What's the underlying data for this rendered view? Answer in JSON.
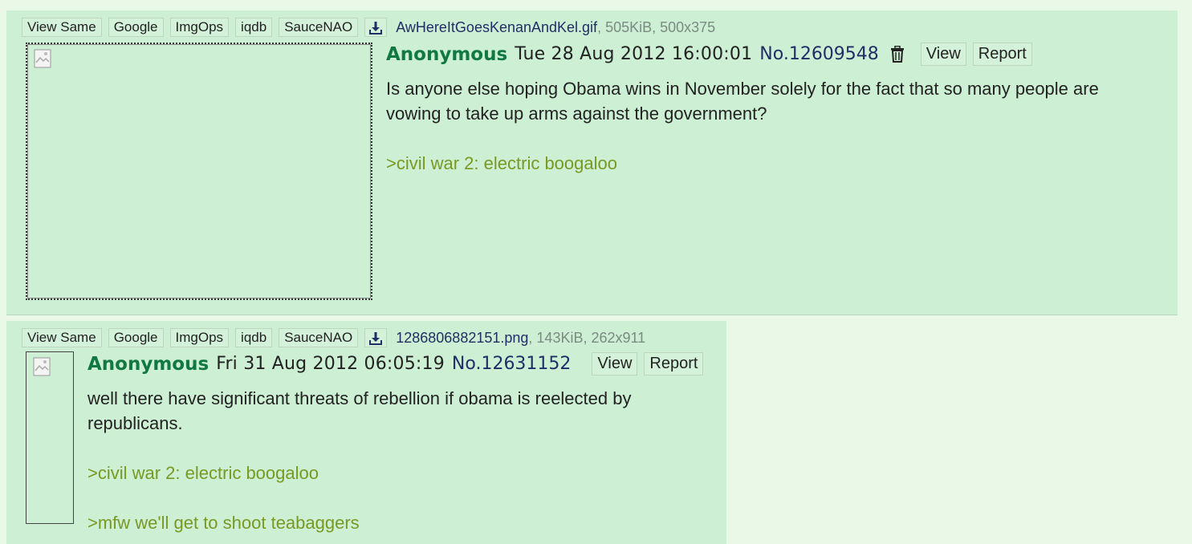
{
  "posts": [
    {
      "search_buttons": [
        "View Same",
        "Google",
        "ImgOps",
        "iqdb",
        "SauceNAO"
      ],
      "file": {
        "name": "AwHereItGoesKenanAndKel.gif",
        "meta": ", 505KiB, 500x375"
      },
      "author": "Anonymous",
      "date": "Tue 28 Aug 2012 16:00:01",
      "number": "No.12609548",
      "view_label": "View",
      "report_label": "Report",
      "text_line1": "Is anyone else hoping Obama wins in November solely for the fact that so many people are",
      "text_line2": "vowing to take up arms against the government?",
      "quote1": ">civil war 2: electric boogaloo"
    },
    {
      "search_buttons": [
        "View Same",
        "Google",
        "ImgOps",
        "iqdb",
        "SauceNAO"
      ],
      "file": {
        "name": "1286806882151.png",
        "meta": ", 143KiB, 262x911"
      },
      "author": "Anonymous",
      "date": "Fri 31 Aug 2012 06:05:19",
      "number": "No.12631152",
      "view_label": "View",
      "report_label": "Report",
      "text_line1": "well there have significant threats of rebellion if obama is reelected by",
      "text_line2": "republicans.",
      "quote1": ">civil war 2: electric boogaloo",
      "quote2": ">mfw we'll get to shoot teabaggers"
    }
  ],
  "icons": {
    "download": "download-icon",
    "trash": "trash-icon",
    "broken_image": "broken-image-icon"
  },
  "colors": {
    "page_bg": "#eaf8e8",
    "post_bg": "#cdefd4",
    "name": "#117743",
    "quote": "#789922",
    "post_number": "#1f2f66"
  }
}
